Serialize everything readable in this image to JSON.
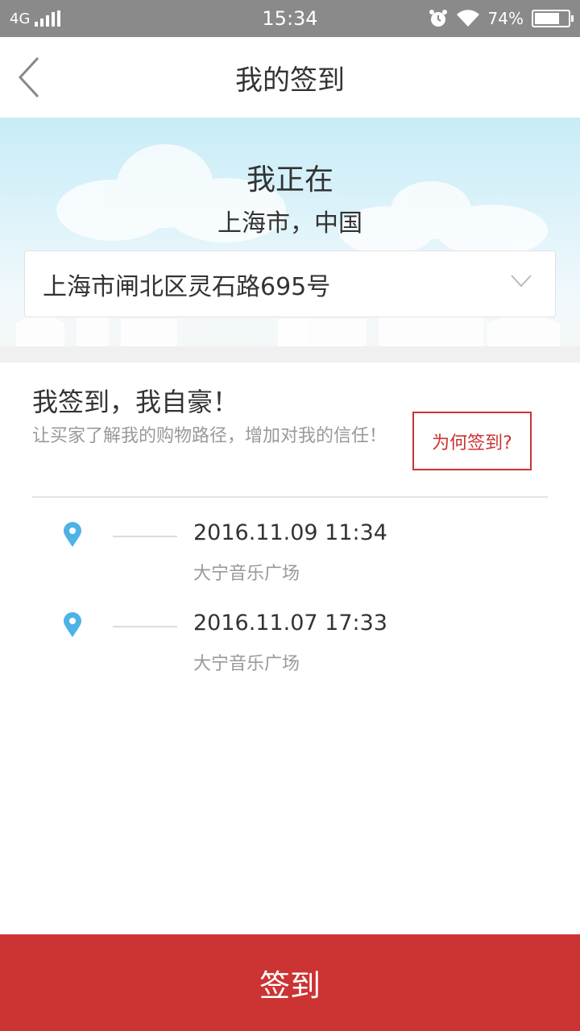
{
  "status_bar": {
    "network": "4G",
    "time": "15:34",
    "battery_percent": "74%",
    "battery_level": 0.74
  },
  "header": {
    "title": "我的签到"
  },
  "location": {
    "heading": "我正在",
    "city": "上海市，中国",
    "address": "上海市闸北区灵石路695号"
  },
  "slogan": {
    "title": "我签到，我自豪！",
    "description": "让买家了解我的购物路径，增加对我的信任！",
    "why_button": "为何签到?"
  },
  "history": [
    {
      "time": "2016.11.09 11:34",
      "place": "大宁音乐广场"
    },
    {
      "time": "2016.11.07 17:33",
      "place": "大宁音乐广场"
    }
  ],
  "checkin_button": "签到",
  "colors": {
    "accent": "#cc3333",
    "pin": "#4db3e6",
    "status_bar": "#8a8a8a"
  }
}
